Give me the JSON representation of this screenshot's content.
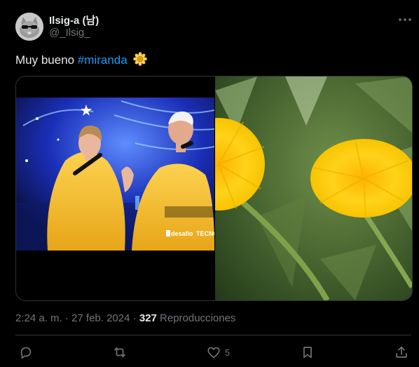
{
  "author": {
    "display_name": "Ilsig-a (남)",
    "handle": "@_Ilsig_"
  },
  "tweet": {
    "text_before": "Muy bueno ",
    "hashtag": "#miranda",
    "emoji": "🌼"
  },
  "media": {
    "left_overlay_text_brand": "desafio",
    "left_overlay_text_suffix": "TECNO"
  },
  "meta": {
    "time": "2:24 a. m.",
    "separator": "·",
    "date": "27 feb. 2024",
    "views_count": "327",
    "views_label": "Reproducciones"
  },
  "actions": {
    "like_count": "5"
  },
  "icons": {
    "more": "more-icon",
    "reply": "reply-icon",
    "retweet": "retweet-icon",
    "like": "heart-icon",
    "bookmark": "bookmark-icon",
    "share": "share-icon"
  },
  "colors": {
    "background": "#000000",
    "text_primary": "#e7e9ea",
    "text_secondary": "#71767b",
    "link": "#1d9bf0",
    "border": "#2f3336"
  }
}
